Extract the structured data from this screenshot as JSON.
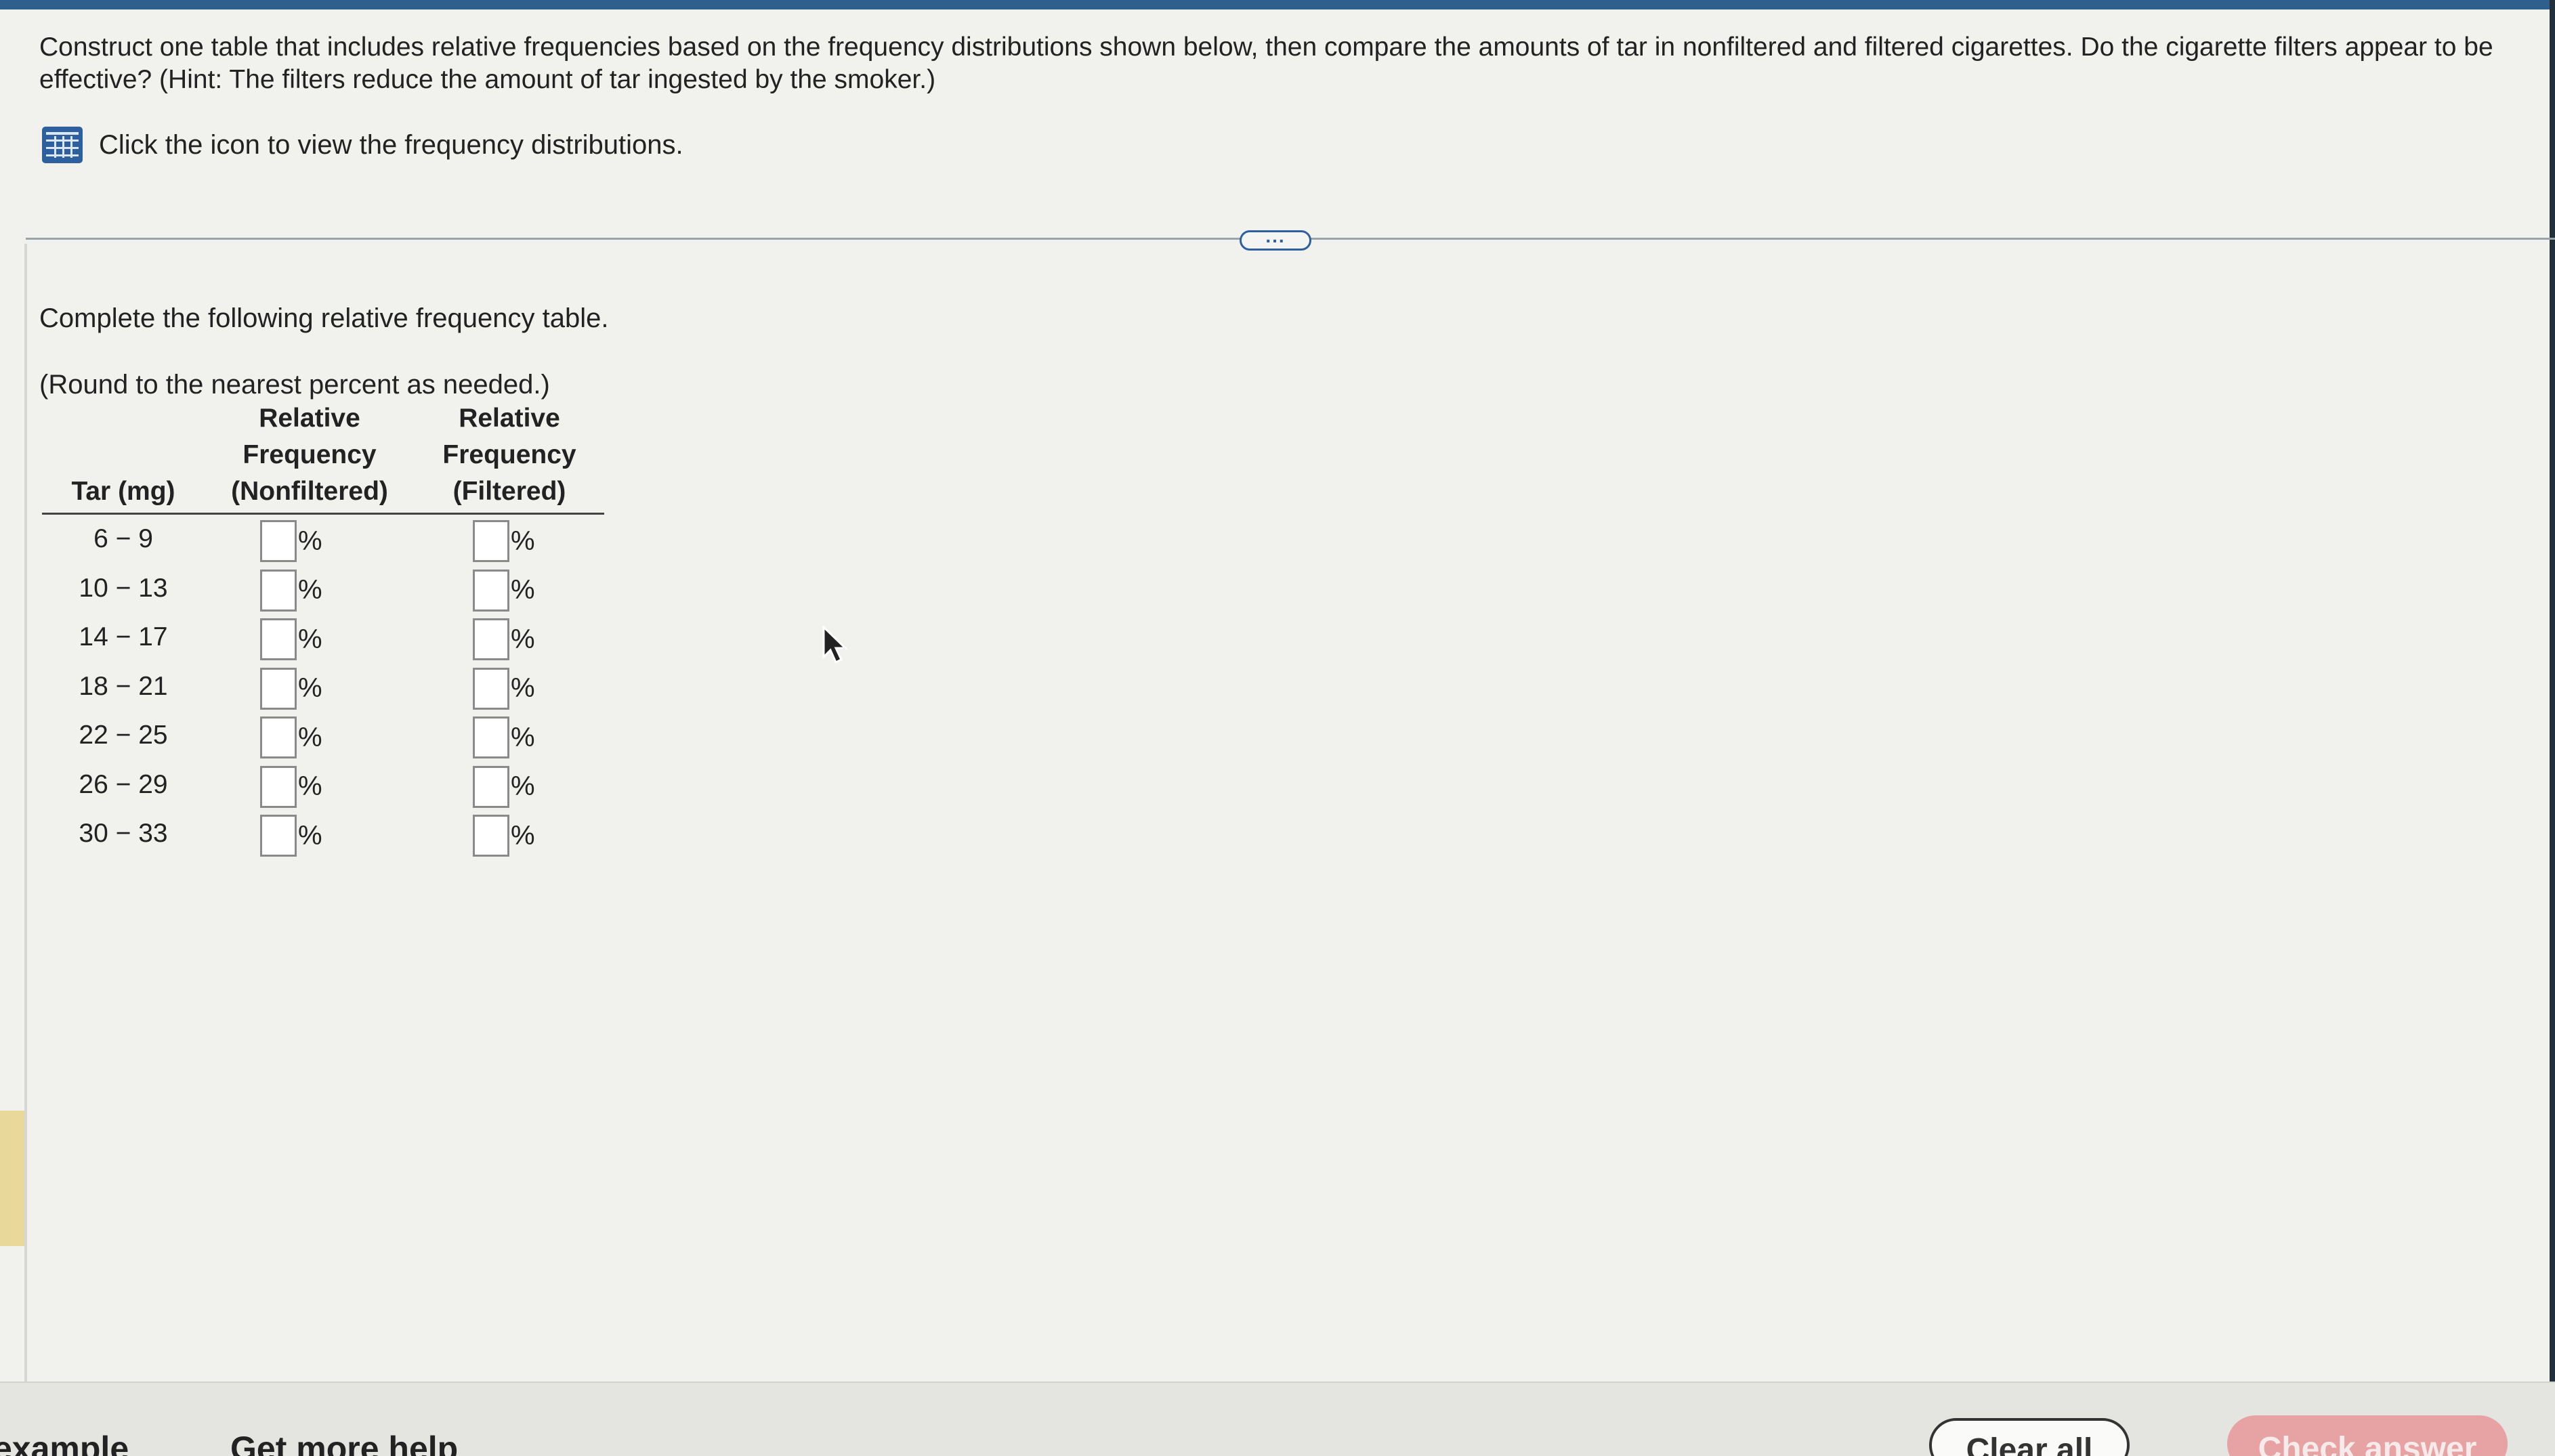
{
  "question": {
    "text": "Construct one table that includes relative frequencies based on the frequency distributions shown below, then compare the amounts of tar in nonfiltered and filtered cigarettes. Do the cigarette filters appear to be effective? (Hint: The filters reduce the amount of tar ingested by the smoker.)"
  },
  "data_link": {
    "icon": "table-grid-icon",
    "text": "Click the icon to view the frequency distributions."
  },
  "expand": {
    "label": "..."
  },
  "instruction": "Complete the following relative frequency table.",
  "round_note": "(Round to the nearest percent as needed.)",
  "table": {
    "headers": {
      "tar": "Tar (mg)",
      "nonfiltered": [
        "Relative",
        "Frequency",
        "(Nonfiltered)"
      ],
      "filtered": [
        "Relative",
        "Frequency",
        "(Filtered)"
      ]
    },
    "percent_sign": "%",
    "rows": [
      {
        "tar": "6 − 9",
        "nonfiltered": "",
        "filtered": ""
      },
      {
        "tar": "10 − 13",
        "nonfiltered": "",
        "filtered": ""
      },
      {
        "tar": "14 − 17",
        "nonfiltered": "",
        "filtered": ""
      },
      {
        "tar": "18 − 21",
        "nonfiltered": "",
        "filtered": ""
      },
      {
        "tar": "22 − 25",
        "nonfiltered": "",
        "filtered": ""
      },
      {
        "tar": "26 − 29",
        "nonfiltered": "",
        "filtered": ""
      },
      {
        "tar": "30 − 33",
        "nonfiltered": "",
        "filtered": ""
      }
    ]
  },
  "footer": {
    "example_link": "example",
    "help_link": "Get more help",
    "clear_all": "Clear all",
    "check_answer": "Check answer"
  },
  "colors": {
    "accent": "#2e5f9e",
    "check_button": "#e7a3a3",
    "background": "#f1f1ee"
  }
}
